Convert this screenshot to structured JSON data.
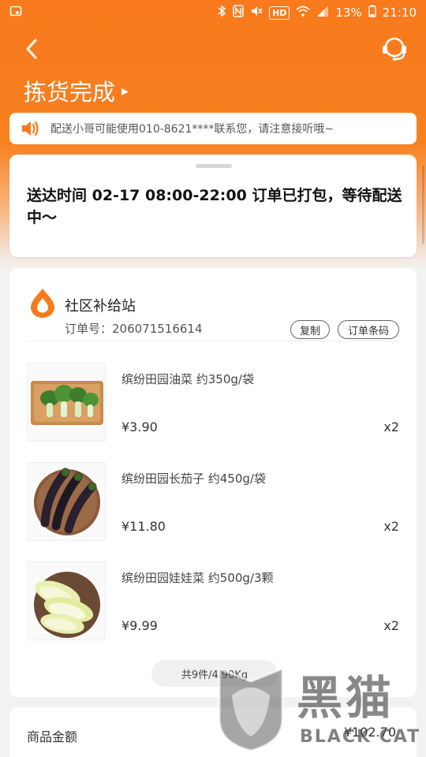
{
  "status_bar": {
    "battery_percent": "13%",
    "time": "21:10",
    "hd_badge": "HD",
    "icons": [
      "gallery-icon",
      "bluetooth-icon",
      "nfc-icon",
      "mute-icon",
      "wifi-icon",
      "signal-icon",
      "battery-icon"
    ]
  },
  "nav": {
    "back_icon": "chevron-left-icon",
    "service_icon": "headset-icon",
    "title": "拣货完成",
    "title_arrow": "▸"
  },
  "notice": {
    "icon": "speaker-icon",
    "text": "配送小哥可能使用010-8621****联系您，请注意接听哦~"
  },
  "delivery": {
    "text": "送达时间  02-17 08:00-22:00 订单已打包，等待配送中～"
  },
  "store": {
    "name": "社区补给站",
    "order_number": "订单号：206071516614",
    "copy_label": "复制",
    "barcode_label": "订单条码"
  },
  "items": [
    {
      "name": "缤纷田园油菜 约350g/袋",
      "price": "¥3.90",
      "qty": "x2"
    },
    {
      "name": "缤纷田园长茄子 约450g/袋",
      "price": "¥11.80",
      "qty": "x2"
    },
    {
      "name": "缤纷田园娃娃菜 约500g/3颗",
      "price": "¥9.99",
      "qty": "x2"
    }
  ],
  "total": {
    "summary": "共9件/4.90Kg"
  },
  "amount": {
    "label": "商品金额",
    "value": "¥102.70"
  },
  "watermark": {
    "chinese": "黑猫",
    "english": "BLACK CAT"
  },
  "colors": {
    "brand_orange": "#f87a1c"
  }
}
